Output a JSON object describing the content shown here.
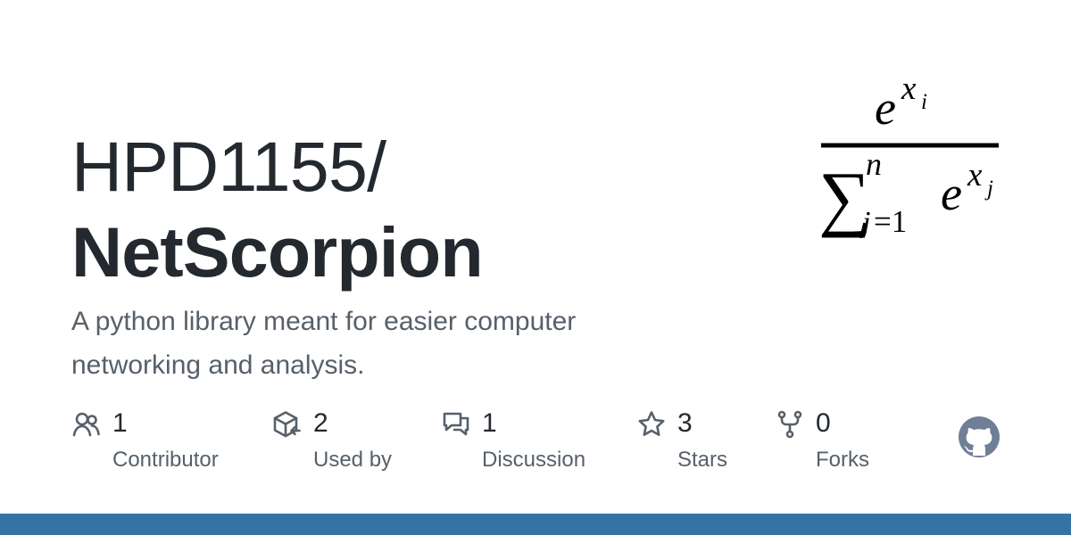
{
  "repository": {
    "owner_path": "HPD1155/",
    "name": "NetScorpion",
    "description": "A python library meant for easier computer networking and analysis."
  },
  "stats": [
    {
      "count": "1",
      "label": "Contributor",
      "icon": "people-icon"
    },
    {
      "count": "2",
      "label": "Used by",
      "icon": "package-dependents-icon"
    },
    {
      "count": "1",
      "label": "Discussion",
      "icon": "comment-discussion-icon"
    },
    {
      "count": "3",
      "label": "Stars",
      "icon": "star-icon"
    },
    {
      "count": "0",
      "label": "Forks",
      "icon": "repo-forked-icon"
    }
  ],
  "avatar": {
    "image_type": "softmax formula image"
  },
  "brand": {
    "icon": "github-mark-icon"
  },
  "colors": {
    "background": "#ffffff",
    "text_primary": "#24292f",
    "text_secondary": "#57606a",
    "github_mark": "#6e7f96",
    "bottom_bar": "#3572a5"
  }
}
